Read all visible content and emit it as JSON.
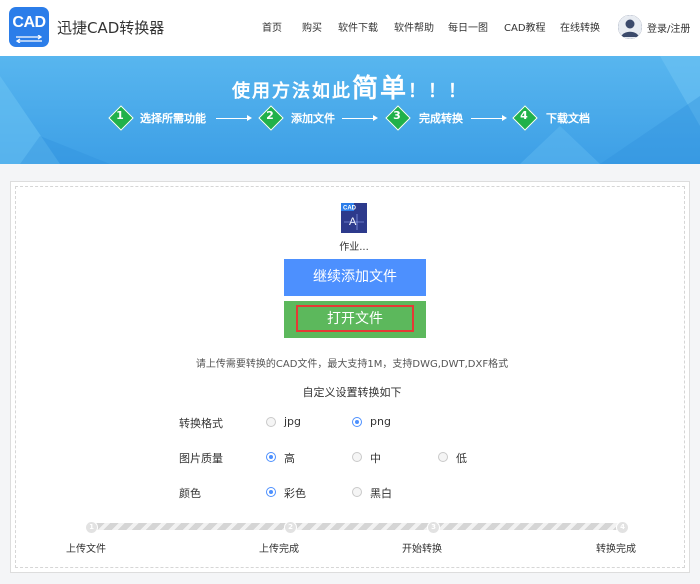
{
  "header": {
    "logo_text": "CAD",
    "brand": "迅捷CAD转换器",
    "nav": [
      "首页",
      "购买",
      "软件下载",
      "软件帮助",
      "每日一图",
      "CAD教程",
      "在线转换"
    ],
    "login": "登录/注册"
  },
  "banner": {
    "title_pre": "使用方法如此",
    "title_big": "简单",
    "title_post": "！！！",
    "steps": [
      {
        "num": "1",
        "label": "选择所需功能"
      },
      {
        "num": "2",
        "label": "添加文件"
      },
      {
        "num": "3",
        "label": "完成转换"
      },
      {
        "num": "4",
        "label": "下载文档"
      }
    ]
  },
  "file": {
    "icon_text": "CAD",
    "icon_sub": "A",
    "name": "作业..."
  },
  "buttons": {
    "add": "继续添加文件",
    "open": "打开文件"
  },
  "hint": "请上传需要转换的CAD文件，最大支持1M，支持DWG,DWT,DXF格式",
  "settings": {
    "title": "自定义设置转换如下",
    "format": {
      "label": "转换格式",
      "options": [
        "jpg",
        "png"
      ],
      "selected": "png"
    },
    "quality": {
      "label": "图片质量",
      "options": [
        "高",
        "中",
        "低"
      ],
      "selected": "高"
    },
    "color": {
      "label": "颜色",
      "options": [
        "彩色",
        "黑白"
      ],
      "selected": "彩色"
    }
  },
  "progress": {
    "steps": [
      {
        "num": "1",
        "label": "上传文件"
      },
      {
        "num": "2",
        "label": "上传完成"
      },
      {
        "num": "3",
        "label": "开始转换"
      },
      {
        "num": "4",
        "label": "转换完成"
      }
    ]
  },
  "colors": {
    "accent_blue": "#4d90fe",
    "accent_green": "#5cb85c",
    "banner_blue": "#3d9fe6",
    "highlight_red": "#e53935"
  }
}
